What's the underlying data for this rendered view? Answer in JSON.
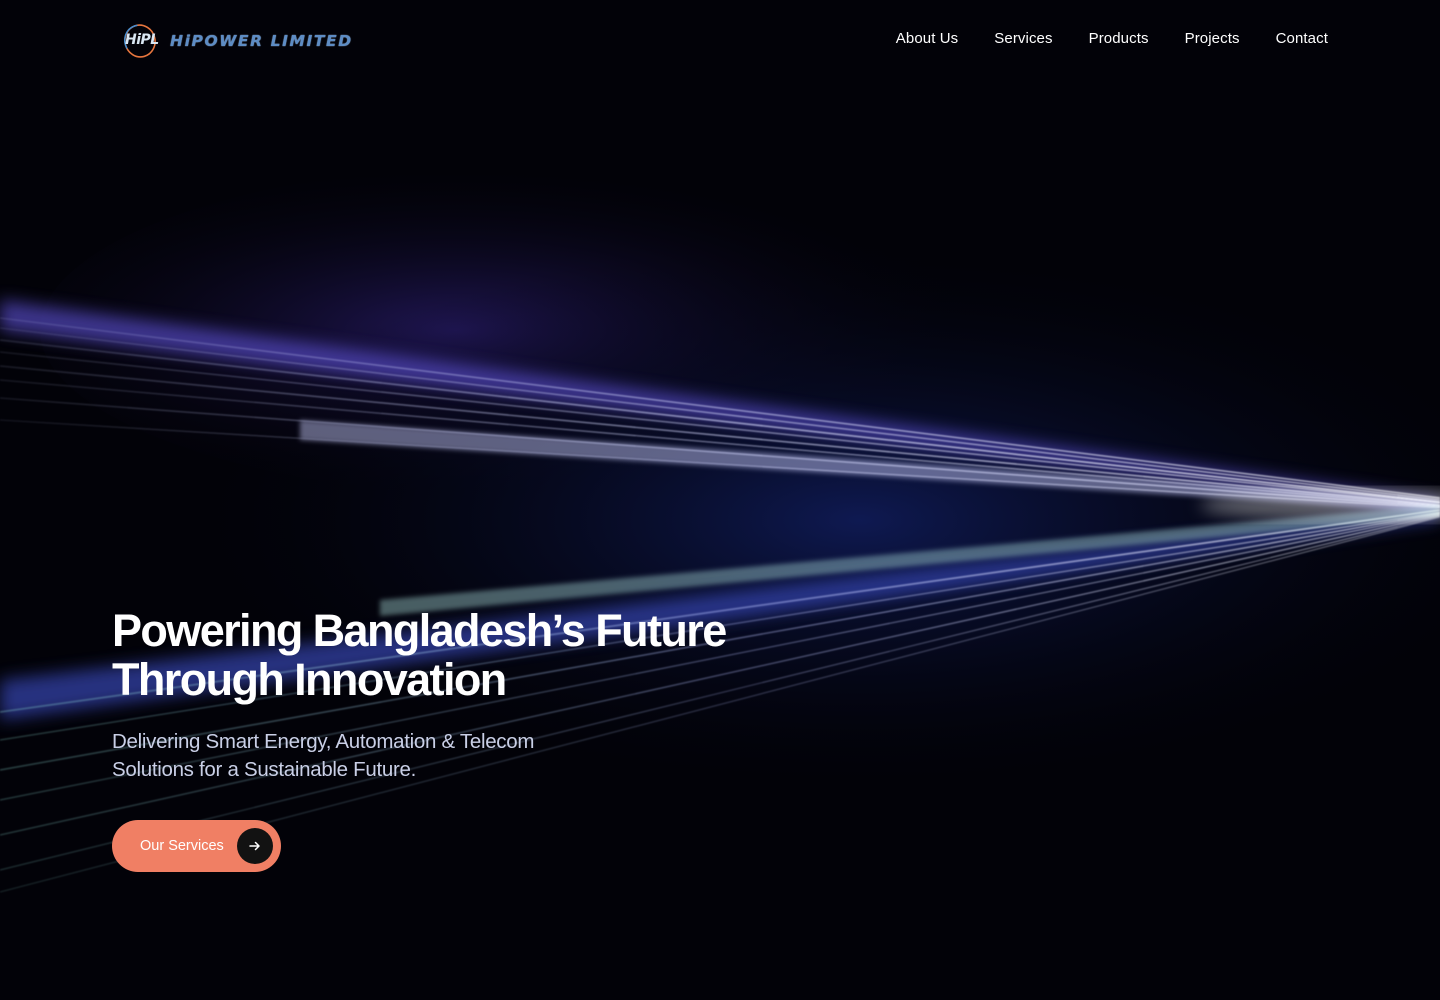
{
  "header": {
    "logo_mark": "HiPL",
    "logo_text": "HiPOWER LIMITED",
    "nav": [
      {
        "label": "About Us"
      },
      {
        "label": "Services"
      },
      {
        "label": "Products"
      },
      {
        "label": "Projects"
      },
      {
        "label": "Contact"
      }
    ]
  },
  "hero": {
    "headline_line1": "Powering Bangladesh’s Future",
    "headline_line2": "Through Innovation",
    "subtitle_line1": "Delivering Smart Energy, Automation & Telecom",
    "subtitle_line2": "Solutions for a Sustainable Future.",
    "cta_label": "Our Services",
    "cta_icon": "arrow-right-icon"
  },
  "colors": {
    "background": "#020208",
    "accent": "#f07f64",
    "logo_blue": "#5d8cc4",
    "light_streak": "#9aa8ff"
  }
}
